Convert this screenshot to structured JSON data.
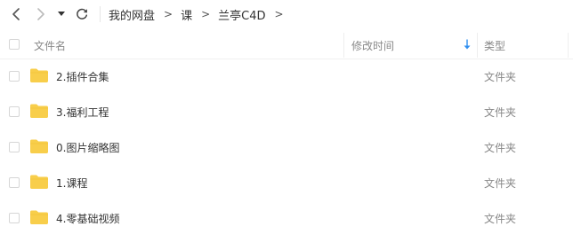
{
  "toolbar": {
    "back_icon": "chevron-left-icon",
    "forward_icon": "chevron-right-icon",
    "history_icon": "triangle-down-icon",
    "refresh_icon": "refresh-icon",
    "breadcrumb": [
      {
        "label": "我的网盘"
      },
      {
        "label": "课"
      },
      {
        "label": "兰亭C4D"
      }
    ],
    "separator": ">"
  },
  "table": {
    "columns": {
      "name": "文件名",
      "modified": "修改时间",
      "type": "类型"
    },
    "sort_icon": "arrow-down-icon",
    "sort_color": "#2e8ef0",
    "folder_color": "#f8ce4b",
    "rows": [
      {
        "name": "2.插件合集",
        "modified": "",
        "type": "文件夹",
        "icon": "folder-icon"
      },
      {
        "name": "3.福利工程",
        "modified": "",
        "type": "文件夹",
        "icon": "folder-icon"
      },
      {
        "name": "0.图片缩略图",
        "modified": "",
        "type": "文件夹",
        "icon": "folder-icon"
      },
      {
        "name": "1.课程",
        "modified": "",
        "type": "文件夹",
        "icon": "folder-icon"
      },
      {
        "name": "4.零基础视频",
        "modified": "",
        "type": "文件夹",
        "icon": "folder-icon"
      }
    ]
  }
}
